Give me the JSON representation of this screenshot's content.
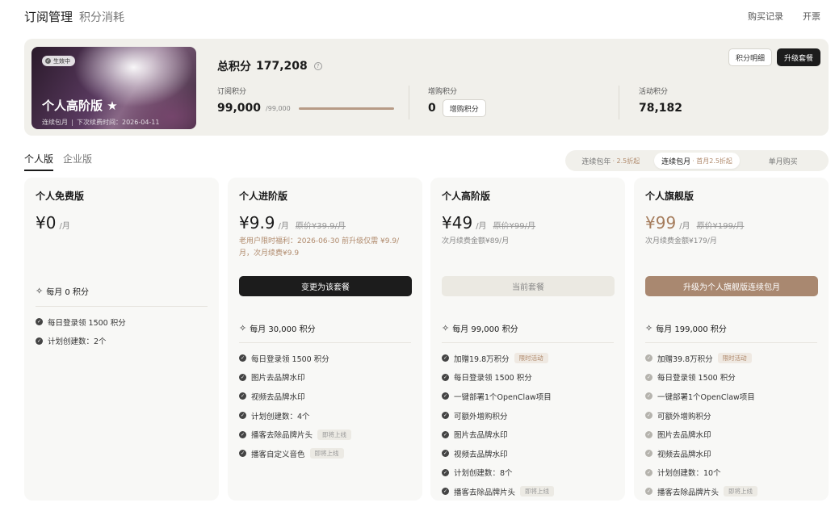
{
  "header": {
    "title": "订阅管理",
    "subtitle": "积分消耗",
    "links": [
      "购买记录",
      "开票"
    ]
  },
  "summary": {
    "plan": {
      "status": "生效中",
      "name": "个人高阶版",
      "star": "★",
      "billing": "连续包月",
      "next_renewal": "下次续费时间：2026-04-11"
    },
    "total_label": "总积分",
    "total_value": "177,208",
    "help_icon": "?",
    "actions": {
      "detail": "积分明细",
      "upgrade": "升级套餐"
    },
    "subscription": {
      "label": "订阅积分",
      "value": "99,000",
      "max": "/99,000",
      "fill_fraction": 1.0
    },
    "addon": {
      "label": "增购积分",
      "value": "0",
      "button": "增购积分"
    },
    "activity": {
      "label": "活动积分",
      "value": "78,182"
    }
  },
  "tabs": [
    {
      "label": "个人版",
      "active": true
    },
    {
      "label": "企业版",
      "active": false
    }
  ],
  "billing_options": [
    {
      "label": "连续包年",
      "discount": "· 2.5折起",
      "active": false
    },
    {
      "label": "连续包月",
      "discount": "· 首月2.5折起",
      "active": true
    },
    {
      "label": "单月购买",
      "discount": "",
      "active": false
    }
  ],
  "plans": [
    {
      "title": "个人免费版",
      "price": "¥0",
      "per": "/月",
      "original": "",
      "note": "",
      "cta": "",
      "monthly": "每月 0 积分",
      "features": [
        {
          "text": "每日登录领 1500 积分",
          "tag": ""
        },
        {
          "text": "计划创建数：2个",
          "tag": ""
        }
      ]
    },
    {
      "title": "个人进阶版",
      "price": "¥9.9",
      "per": "/月",
      "original": "原价¥39.9/月",
      "note": "老用户限时福利：2026-06-30 前升级仅需 ¥9.9/月，次月续费¥9.9",
      "cta": "变更为该套餐",
      "monthly": "每月 30,000 积分",
      "features": [
        {
          "text": "每日登录领 1500 积分",
          "tag": ""
        },
        {
          "text": "图片去品牌水印",
          "tag": ""
        },
        {
          "text": "视频去品牌水印",
          "tag": ""
        },
        {
          "text": "计划创建数：4个",
          "tag": ""
        },
        {
          "text": "播客去除品牌片头",
          "tag": "即将上线"
        },
        {
          "text": "播客自定义音色",
          "tag": "即将上线"
        }
      ]
    },
    {
      "title": "个人高阶版",
      "price": "¥49",
      "per": "/月",
      "original": "原价¥99/月",
      "note": "次月续费金额¥89/月",
      "cta": "当前套餐",
      "monthly": "每月 99,000 积分",
      "features": [
        {
          "text": "加赠19.8万积分",
          "tag": "限时活动"
        },
        {
          "text": "每日登录领 1500 积分",
          "tag": ""
        },
        {
          "text": "一键部署1个OpenClaw项目",
          "tag": ""
        },
        {
          "text": "可额外增购积分",
          "tag": ""
        },
        {
          "text": "图片去品牌水印",
          "tag": ""
        },
        {
          "text": "视频去品牌水印",
          "tag": ""
        },
        {
          "text": "计划创建数：8个",
          "tag": ""
        },
        {
          "text": "播客去除品牌片头",
          "tag": "即将上线"
        }
      ]
    },
    {
      "title": "个人旗舰版",
      "price": "¥99",
      "per": "/月",
      "original": "原价¥199/月",
      "note": "次月续费金额¥179/月",
      "cta": "升级为个人旗舰版连续包月",
      "monthly": "每月 199,000 积分",
      "features": [
        {
          "text": "加赠39.8万积分",
          "tag": "限时活动"
        },
        {
          "text": "每日登录领 1500 积分",
          "tag": ""
        },
        {
          "text": "一键部署1个OpenClaw项目",
          "tag": ""
        },
        {
          "text": "可额外增购积分",
          "tag": ""
        },
        {
          "text": "图片去品牌水印",
          "tag": ""
        },
        {
          "text": "视频去品牌水印",
          "tag": ""
        },
        {
          "text": "计划创建数：10个",
          "tag": ""
        },
        {
          "text": "播客去除品牌片头",
          "tag": "即将上线"
        }
      ]
    }
  ],
  "icons": {
    "check": "✓",
    "sparkle": "✧",
    "status_check": "✓"
  },
  "colors": {
    "accent_gold": "#a98870",
    "dark_button": "#1c1c1c",
    "panel_bg": "#f1f0eb"
  }
}
